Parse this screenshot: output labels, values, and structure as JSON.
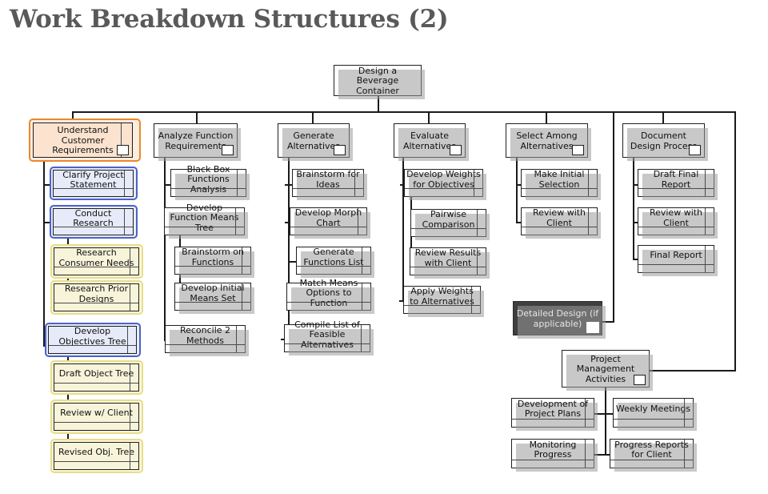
{
  "page": {
    "title": "Work Breakdown Structures (2)"
  },
  "colors": {
    "title_text": "#595959",
    "box_border": "#1f1f1f",
    "box_fill": "#ffffff",
    "shadow": "#9a9a9a",
    "accent_orange": "#e8892b",
    "accent_blue": "#4a63c8",
    "accent_yellow": "#e8dd8a",
    "dark_box_fill": "#3f3f3f",
    "dark_box_text": "#e6e6e6",
    "connector": "#1a1a1a"
  },
  "diagram": {
    "type": "work-breakdown-structure",
    "root": {
      "label": "Design a Beverage Container"
    },
    "columns": [
      {
        "header": "Understand Customer Requirements",
        "highlight": "orange",
        "children": [
          {
            "label": "Clarify Project Statement",
            "highlight": "blue",
            "level": 2
          },
          {
            "label": "Conduct Research",
            "highlight": "blue",
            "level": 2
          },
          {
            "label": "Research Consumer Needs",
            "highlight": "yellow",
            "level": 3
          },
          {
            "label": "Research Prior Designs",
            "highlight": "yellow",
            "level": 3
          },
          {
            "label": "Develop Objectives Tree",
            "highlight": "blue",
            "level": 2
          },
          {
            "label": "Draft Object Tree",
            "highlight": "yellow",
            "level": 3
          },
          {
            "label": "Review w/ Client",
            "highlight": "yellow",
            "level": 3
          },
          {
            "label": "Revised Obj. Tree",
            "highlight": "yellow",
            "level": 3
          }
        ]
      },
      {
        "header": "Analyze Function Requirements",
        "highlight": "none",
        "children": [
          {
            "label": "Black Box Functions Analysis",
            "level": 2
          },
          {
            "label": "Develop Function Means Tree",
            "level": 2
          },
          {
            "label": "Brainstorm on Functions",
            "level": 3
          },
          {
            "label": "Develop Initial Means Set",
            "level": 3
          },
          {
            "label": "Reconcile 2 Methods",
            "level": 2
          }
        ]
      },
      {
        "header": "Generate Alternatives",
        "highlight": "none",
        "children": [
          {
            "label": "Brainstorm for Ideas",
            "level": 2
          },
          {
            "label": "Develop Morph Chart",
            "level": 2
          },
          {
            "label": "Generate Functions List",
            "level": 3
          },
          {
            "label": "Match Means Options to Function",
            "level": 3
          },
          {
            "label": "Compile List of Feasible Alternatives",
            "level": 2
          }
        ]
      },
      {
        "header": "Evaluate Alternatives",
        "highlight": "none",
        "children": [
          {
            "label": "Develop Weights for Objectives",
            "level": 2
          },
          {
            "label": "Pairwise Comparison",
            "level": 3
          },
          {
            "label": "Review Results with Client",
            "level": 3
          },
          {
            "label": "Apply Weights to Alternatives",
            "level": 2
          }
        ]
      },
      {
        "header": "Select Among Alternatives",
        "highlight": "none",
        "children": [
          {
            "label": "Make Initial Selection",
            "level": 2
          },
          {
            "label": "Review with Client",
            "level": 2
          }
        ]
      },
      {
        "header": "Document Design Process",
        "highlight": "none",
        "children": [
          {
            "label": "Draft Final Report",
            "level": 2
          },
          {
            "label": "Review with Client",
            "level": 2
          },
          {
            "label": "Final Report",
            "level": 2
          }
        ]
      }
    ],
    "detailed_design": {
      "label": "Detailed Design (if applicable)",
      "style": "dark"
    },
    "project_management": {
      "header": "Project Management Activities",
      "children": [
        {
          "label": "Development of Project Plans"
        },
        {
          "label": "Weekly Meetings"
        },
        {
          "label": "Monitoring Progress"
        },
        {
          "label": "Progress Reports for Client"
        }
      ]
    }
  },
  "labels": {
    "root": "Design a Beverage Container",
    "c0_h": "Understand Customer Requirements",
    "c0_0": "Clarify Project Statement",
    "c0_1": "Conduct Research",
    "c0_2": "Research Consumer Needs",
    "c0_3": "Research Prior Designs",
    "c0_4": "Develop Objectives Tree",
    "c0_5": "Draft Object Tree",
    "c0_6": "Review w/ Client",
    "c0_7": "Revised Obj. Tree",
    "c1_h": "Analyze Function Requirements",
    "c1_0": "Black Box Functions Analysis",
    "c1_1": "Develop Function Means Tree",
    "c1_2": "Brainstorm on Functions",
    "c1_3": "Develop Initial Means Set",
    "c1_4": "Reconcile 2 Methods",
    "c2_h": "Generate Alternatives",
    "c2_0": "Brainstorm for Ideas",
    "c2_1": "Develop Morph Chart",
    "c2_2": "Generate Functions List",
    "c2_3": "Match Means Options to Function",
    "c2_4": "Compile List of Feasible Alternatives",
    "c3_h": "Evaluate Alternatives",
    "c3_0": "Develop Weights for Objectives",
    "c3_1": "Pairwise Comparison",
    "c3_2": "Review Results with Client",
    "c3_3": "Apply Weights to Alternatives",
    "c4_h": "Select Among Alternatives",
    "c4_0": "Make Initial Selection",
    "c4_1": "Review with Client",
    "c5_h": "Document Design Process",
    "c5_0": "Draft Final Report",
    "c5_1": "Review with Client",
    "c5_2": "Final Report",
    "dd": "Detailed Design (if applicable)",
    "pm_h": "Project Management Activities",
    "pm_0": "Development of Project Plans",
    "pm_1": "Weekly Meetings",
    "pm_2": "Monitoring Progress",
    "pm_3": "Progress Reports for Client"
  }
}
